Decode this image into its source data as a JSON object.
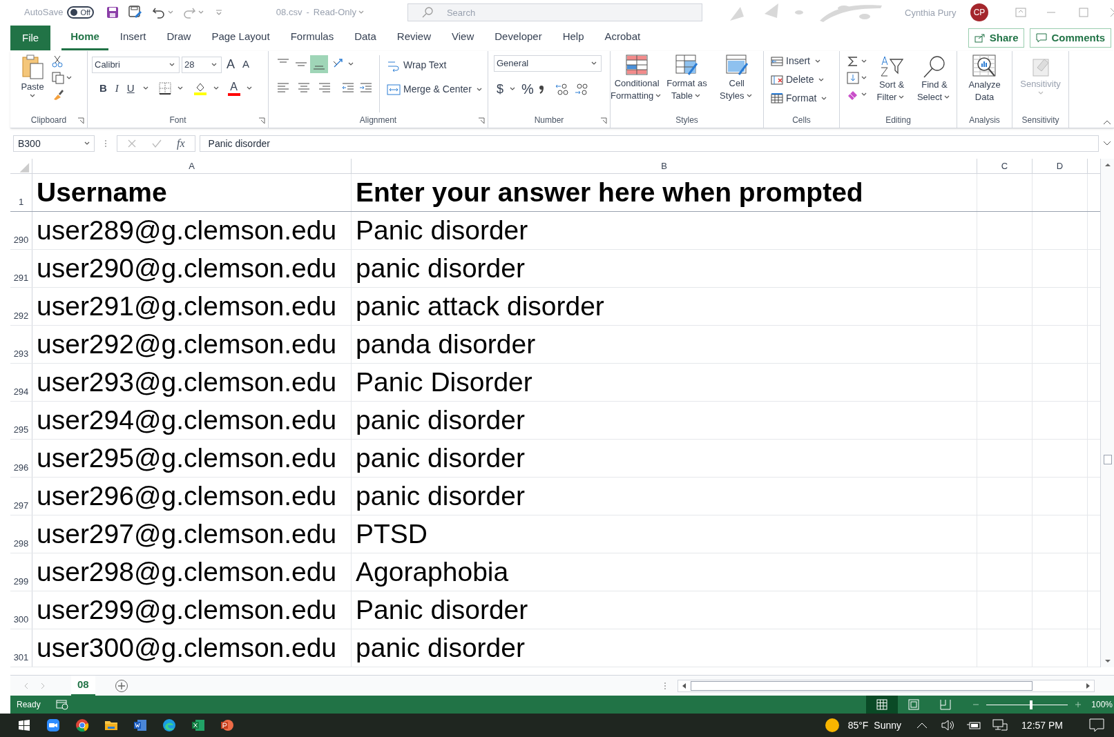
{
  "title_bar": {
    "autosave_label": "AutoSave",
    "autosave_toggle": {
      "label": "Off",
      "on": false
    },
    "file_name": "08.csv",
    "separator": "-",
    "mode": "Read-Only",
    "search": {
      "placeholder": "Search"
    },
    "user_name": "Cynthia Pury",
    "avatar_initials": "CP"
  },
  "menu_tabs": [
    {
      "label": "File",
      "kind": "file",
      "selected": false
    },
    {
      "label": "Home",
      "kind": "tab",
      "selected": true
    },
    {
      "label": "Insert",
      "kind": "tab",
      "selected": false
    },
    {
      "label": "Draw",
      "kind": "tab",
      "selected": false
    },
    {
      "label": "Page Layout",
      "kind": "tab",
      "selected": false
    },
    {
      "label": "Formulas",
      "kind": "tab",
      "selected": false
    },
    {
      "label": "Data",
      "kind": "tab",
      "selected": false
    },
    {
      "label": "Review",
      "kind": "tab",
      "selected": false
    },
    {
      "label": "View",
      "kind": "tab",
      "selected": false
    },
    {
      "label": "Developer",
      "kind": "tab",
      "selected": false
    },
    {
      "label": "Help",
      "kind": "tab",
      "selected": false
    },
    {
      "label": "Acrobat",
      "kind": "tab",
      "selected": false
    }
  ],
  "share_button": "Share",
  "comments_button": "Comments",
  "ribbon": {
    "clipboard": {
      "paste": "Paste",
      "label": "Clipboard"
    },
    "font": {
      "font_name": "Calibri",
      "font_size": "28",
      "grow": "A",
      "shrink": "A",
      "bold": "B",
      "italic": "I",
      "underline": "U",
      "font_color": "A",
      "label": "Font"
    },
    "alignment": {
      "bottom_align_selected": true,
      "wrap_text": "Wrap Text",
      "merge": "Merge & Center",
      "label": "Alignment"
    },
    "number": {
      "format": "General",
      "currency": "$",
      "percent": "%",
      "label": "Number"
    },
    "styles": {
      "buttons": [
        [
          "Conditional",
          "Formatting"
        ],
        [
          "Format as",
          "Table"
        ],
        [
          "Cell",
          "Styles"
        ]
      ],
      "label": "Styles"
    },
    "cells": {
      "buttons": [
        "Insert",
        "Delete",
        "Format"
      ],
      "label": "Cells"
    },
    "editing": {
      "buttons": [
        [
          "Sort &",
          "Filter"
        ],
        [
          "Find &",
          "Select"
        ]
      ],
      "label": "Editing"
    },
    "analysis": {
      "button": [
        "Analyze",
        "Data"
      ],
      "label": "Analysis"
    },
    "sensitivity": {
      "button": "Sensitivity",
      "disabled": true,
      "label": "Sensitivity"
    }
  },
  "formula_bar": {
    "name_box": "B300",
    "fx": "fx",
    "formula": "Panic disorder"
  },
  "columns": [
    "A",
    "B",
    "C",
    "D"
  ],
  "header_row": {
    "number": "1",
    "cells": [
      "Username",
      "Enter your answer here when prompted"
    ]
  },
  "rows": [
    {
      "number": "290",
      "cells": [
        "user289@g.clemson.edu",
        "Panic disorder"
      ]
    },
    {
      "number": "291",
      "cells": [
        "user290@g.clemson.edu",
        "panic disorder"
      ]
    },
    {
      "number": "292",
      "cells": [
        "user291@g.clemson.edu",
        "panic attack disorder"
      ]
    },
    {
      "number": "293",
      "cells": [
        "user292@g.clemson.edu",
        "panda disorder"
      ]
    },
    {
      "number": "294",
      "cells": [
        "user293@g.clemson.edu",
        "Panic Disorder"
      ]
    },
    {
      "number": "295",
      "cells": [
        "user294@g.clemson.edu",
        "panic disorder"
      ]
    },
    {
      "number": "296",
      "cells": [
        "user295@g.clemson.edu",
        "panic disorder"
      ]
    },
    {
      "number": "297",
      "cells": [
        "user296@g.clemson.edu",
        "panic disorder"
      ]
    },
    {
      "number": "298",
      "cells": [
        "user297@g.clemson.edu",
        "PTSD"
      ]
    },
    {
      "number": "299",
      "cells": [
        "user298@g.clemson.edu",
        "Agoraphobia"
      ]
    },
    {
      "number": "300",
      "cells": [
        "user299@g.clemson.edu",
        "Panic disorder"
      ]
    },
    {
      "number": "301",
      "cells": [
        "user300@g.clemson.edu",
        "panic disorder"
      ]
    }
  ],
  "sheet_tabs": [
    {
      "label": "08",
      "selected": true
    }
  ],
  "status_bar": {
    "status": "Ready",
    "views": [
      {
        "kind": "normal",
        "selected": true
      },
      {
        "kind": "page_layout",
        "selected": false
      },
      {
        "kind": "page_break",
        "selected": false
      }
    ],
    "zoom": {
      "level": 0.55
    },
    "zoom_label": "100%"
  },
  "taskbar": {
    "temperature": "85°F",
    "weather": "Sunny",
    "time": "12:57 PM"
  }
}
